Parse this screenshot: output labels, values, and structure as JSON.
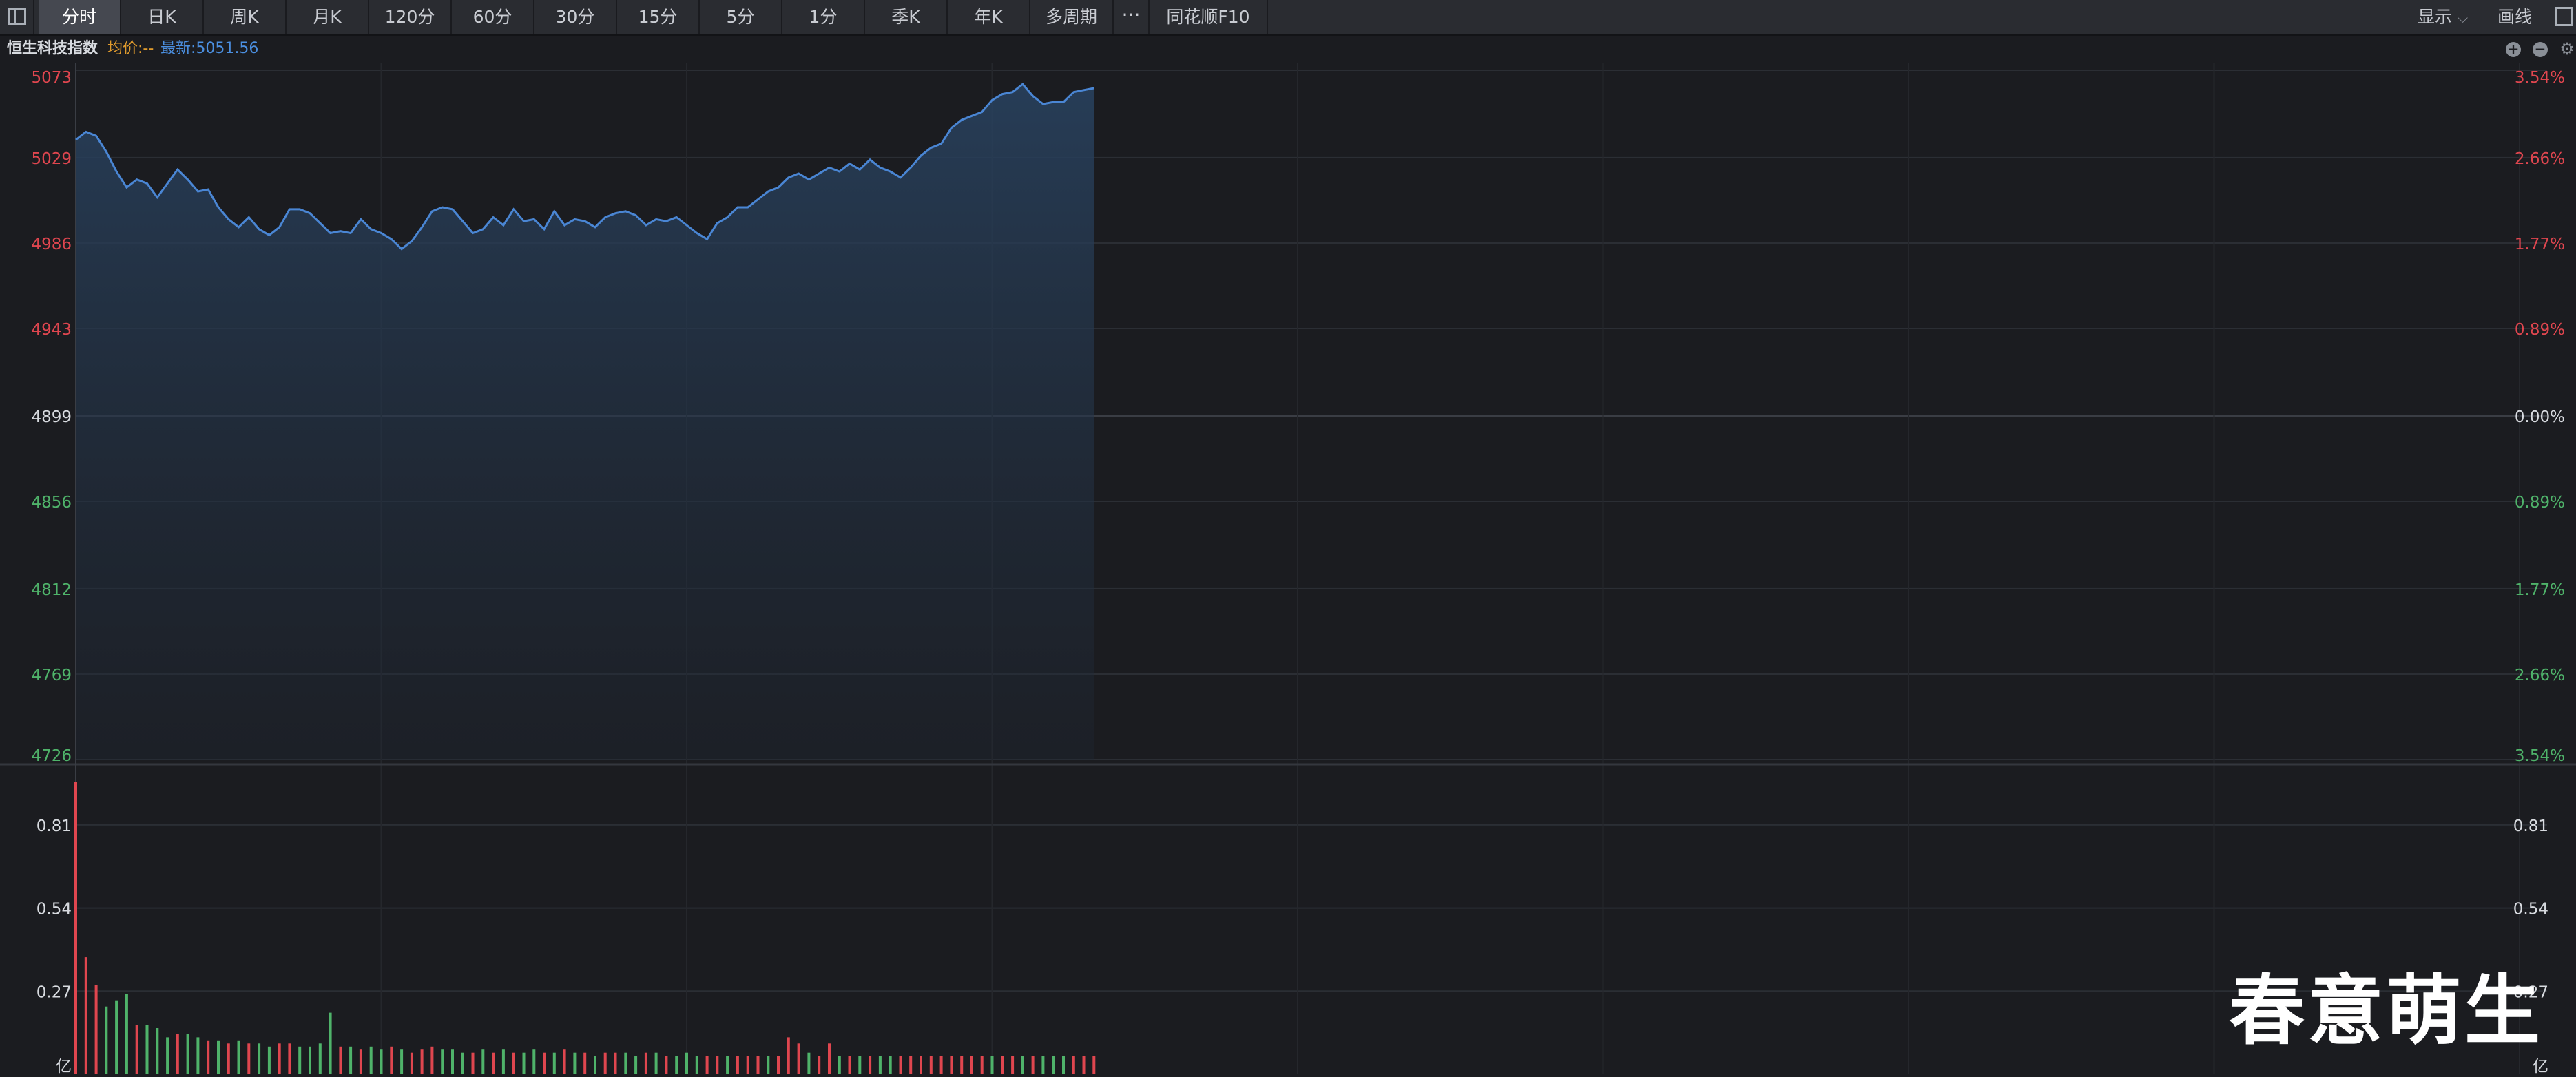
{
  "toolbar": {
    "tabs": [
      {
        "label": "分时",
        "active": true
      },
      {
        "label": "日K"
      },
      {
        "label": "周K"
      },
      {
        "label": "月K"
      },
      {
        "label": "120分"
      },
      {
        "label": "60分"
      },
      {
        "label": "30分"
      },
      {
        "label": "15分"
      },
      {
        "label": "5分"
      },
      {
        "label": "1分"
      },
      {
        "label": "季K"
      },
      {
        "label": "年K"
      },
      {
        "label": "多周期"
      }
    ],
    "more_icon": "···",
    "f10_label": "同花顺F10",
    "display_label": "显示",
    "draw_label": "画线"
  },
  "infobar": {
    "index_name": "恒生科技指数",
    "avg_price": "均价:--",
    "latest_price": "最新:5051.56"
  },
  "price_axis": {
    "left_labels": [
      "5073",
      "5029",
      "4986",
      "4943",
      "4899",
      "4856",
      "4812",
      "4769",
      "4726"
    ],
    "right_labels": [
      "3.54%",
      "2.66%",
      "1.77%",
      "0.89%",
      "0.00%",
      "0.89%",
      "1.77%",
      "2.66%",
      "3.54%"
    ]
  },
  "volume_axis": {
    "left_labels": [
      "0.81",
      "0.54",
      "0.27",
      "亿"
    ],
    "right_labels": [
      "0.81",
      "0.54",
      "0.27",
      "亿"
    ]
  },
  "colors": {
    "up": "#e0464f",
    "down": "#4fb36a",
    "neutral": "#d8dbe0",
    "price_line": "#4a86d4",
    "avg": "#e09b2d"
  },
  "chart_data": {
    "type": "line",
    "title": "恒生科技指数",
    "prev_close": 4899,
    "ylim": [
      4726,
      5073
    ],
    "price": [
      5038,
      5042,
      5040,
      5032,
      5022,
      5014,
      5018,
      5016,
      5009,
      5016,
      5023,
      5018,
      5012,
      5013,
      5004,
      4998,
      4994,
      4999,
      4993,
      4990,
      4994,
      5003,
      5003,
      5001,
      4996,
      4991,
      4992,
      4991,
      4998,
      4993,
      4991,
      4988,
      4983,
      4987,
      4994,
      5002,
      5004,
      5003,
      4997,
      4991,
      4993,
      4999,
      4995,
      5003,
      4997,
      4998,
      4993,
      5002,
      4995,
      4998,
      4997,
      4994,
      4999,
      5001,
      5002,
      5000,
      4995,
      4998,
      4997,
      4999,
      4995,
      4991,
      4988,
      4996,
      4999,
      5004,
      5004,
      5008,
      5012,
      5014,
      5019,
      5021,
      5018,
      5021,
      5024,
      5022,
      5026,
      5023,
      5028,
      5024,
      5022,
      5019,
      5024,
      5030,
      5034,
      5036,
      5044,
      5048,
      5050,
      5052,
      5058,
      5061,
      5062,
      5066,
      5060,
      5056,
      5057,
      5057,
      5062,
      5063,
      5064
    ],
    "volume": [
      0.95,
      0.38,
      0.29,
      0.22,
      0.24,
      0.26,
      0.16,
      0.16,
      0.15,
      0.12,
      0.13,
      0.13,
      0.12,
      0.11,
      0.11,
      0.1,
      0.11,
      0.1,
      0.1,
      0.09,
      0.1,
      0.1,
      0.09,
      0.09,
      0.1,
      0.2,
      0.09,
      0.09,
      0.08,
      0.09,
      0.08,
      0.09,
      0.08,
      0.07,
      0.08,
      0.09,
      0.08,
      0.08,
      0.07,
      0.07,
      0.08,
      0.07,
      0.08,
      0.07,
      0.07,
      0.08,
      0.07,
      0.07,
      0.08,
      0.07,
      0.07,
      0.06,
      0.07,
      0.07,
      0.07,
      0.06,
      0.07,
      0.07,
      0.06,
      0.06,
      0.07,
      0.06,
      0.06,
      0.06,
      0.06,
      0.06,
      0.06,
      0.06,
      0.06,
      0.06,
      0.12,
      0.1,
      0.07,
      0.06,
      0.1,
      0.06,
      0.06,
      0.06,
      0.06,
      0.06,
      0.06,
      0.06,
      0.06,
      0.06,
      0.06,
      0.06,
      0.06,
      0.06,
      0.06,
      0.06,
      0.06,
      0.06,
      0.06,
      0.06,
      0.06,
      0.06,
      0.06,
      0.06,
      0.06,
      0.06,
      0.06
    ],
    "volume_dirs": [
      "u",
      "u",
      "u",
      "d",
      "d",
      "d",
      "u",
      "d",
      "d",
      "d",
      "u",
      "d",
      "d",
      "u",
      "d",
      "u",
      "d",
      "u",
      "d",
      "d",
      "u",
      "u",
      "d",
      "d",
      "d",
      "d",
      "u",
      "d",
      "u",
      "d",
      "d",
      "u",
      "d",
      "u",
      "u",
      "u",
      "d",
      "d",
      "d",
      "u",
      "d",
      "u",
      "d",
      "u",
      "d",
      "d",
      "u",
      "d",
      "u",
      "d",
      "u",
      "d",
      "u",
      "u",
      "d",
      "d",
      "u",
      "d",
      "u",
      "d",
      "d",
      "d",
      "u",
      "u",
      "d",
      "u",
      "u",
      "u",
      "d",
      "u",
      "u",
      "u",
      "d",
      "u",
      "u",
      "d",
      "u",
      "d",
      "u",
      "d",
      "d",
      "u",
      "u",
      "u",
      "u",
      "u",
      "u",
      "u",
      "u",
      "u",
      "d",
      "u",
      "u",
      "d",
      "u",
      "d",
      "d",
      "d",
      "u",
      "u",
      "u"
    ],
    "vol_ylim": [
      0,
      1.0
    ],
    "volume_unit": "亿"
  },
  "watermark": "春意萌生"
}
